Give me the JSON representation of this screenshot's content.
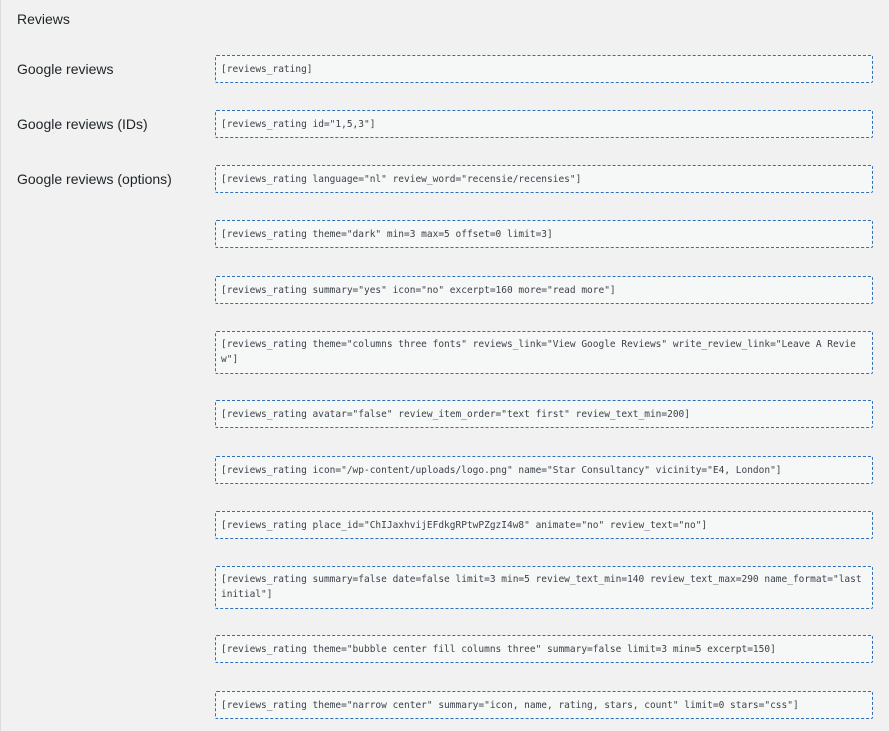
{
  "section": {
    "title": "Reviews"
  },
  "labels": [
    "Google reviews",
    "Google reviews (IDs)",
    "Google reviews (options)"
  ],
  "shortcodes": [
    "[reviews_rating]",
    "[reviews_rating id=\"1,5,3\"]",
    "[reviews_rating language=\"nl\" review_word=\"recensie/recensies\"]",
    "[reviews_rating theme=\"dark\" min=3 max=5 offset=0 limit=3]",
    "[reviews_rating summary=\"yes\" icon=\"no\" excerpt=160 more=\"read more\"]",
    "[reviews_rating theme=\"columns three fonts\" reviews_link=\"View Google Reviews\" write_review_link=\"Leave A Review\"]",
    "[reviews_rating avatar=\"false\" review_item_order=\"text first\" review_text_min=200]",
    "[reviews_rating icon=\"/wp-content/uploads/logo.png\" name=\"Star Consultancy\" vicinity=\"E4, London\"]",
    "[reviews_rating place_id=\"ChIJaxhvijEFdkgRPtwPZgzI4w8\" animate=\"no\" review_text=\"no\"]",
    "[reviews_rating summary=false date=false limit=3 min=5 review_text_min=140 review_text_max=290 name_format=\"last initial\"]",
    "[reviews_rating theme=\"bubble center fill columns three\" summary=false limit=3 min=5 excerpt=150]",
    "[reviews_rating theme=\"narrow center\" summary=\"icon, name, rating, stars, count\" limit=0 stars=\"css\"]"
  ]
}
